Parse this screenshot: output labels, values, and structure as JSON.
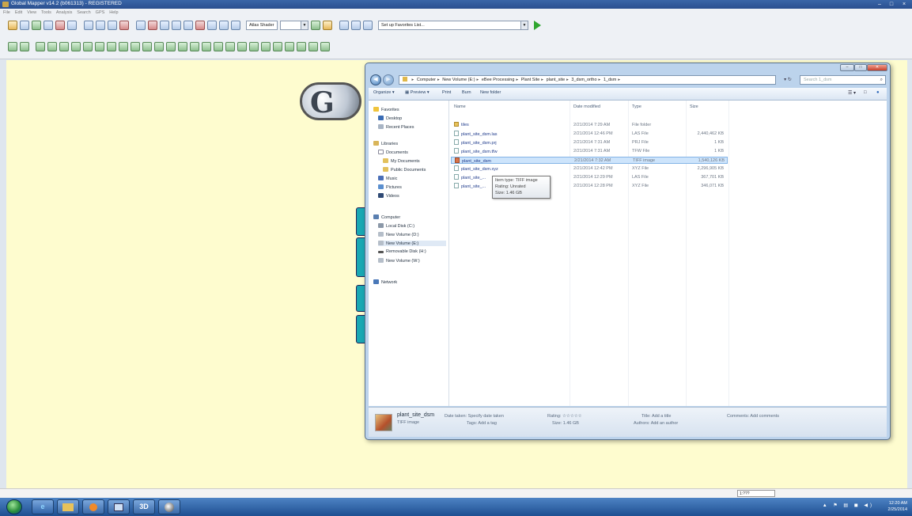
{
  "app": {
    "title": "Global Mapper v14.2 (b061313) - REGISTERED",
    "menu": [
      "File",
      "Edit",
      "View",
      "Tools",
      "Analysis",
      "Search",
      "GPS",
      "Help"
    ],
    "shader_combo": "Atlas Shader",
    "favorites_combo": "Set up Favorites List...",
    "scale_readout": "1:??? "
  },
  "explorer": {
    "breadcrumb": [
      "Computer",
      "New Volume (E:)",
      "eBee Processing",
      "Plant Site",
      "plant_site",
      "3_dsm_ortho",
      "1_dsm"
    ],
    "search_placeholder": "Search 1_dsm",
    "commands": [
      "Organize",
      "Preview",
      "Print",
      "Burn",
      "New folder"
    ],
    "nav": {
      "favorites": "Favorites",
      "desktop": "Desktop",
      "recent": "Recent Places",
      "libraries": "Libraries",
      "documents": "Documents",
      "my_documents": "My Documents",
      "public_documents": "Public Documents",
      "music": "Music",
      "pictures": "Pictures",
      "videos": "Videos",
      "computer": "Computer",
      "local_disk": "Local Disk (C:)",
      "vol_d": "New Volume (D:)",
      "vol_e": "New Volume (E:)",
      "removable": "Removable Disk (H:)",
      "vol_w": "New Volume (W:)",
      "network": "Network"
    },
    "columns": {
      "name": "Name",
      "date": "Date modified",
      "type": "Type",
      "size": "Size"
    },
    "files": [
      {
        "name": "tiles",
        "date": "2/21/2014 7:29 AM",
        "type": "File folder",
        "size": ""
      },
      {
        "name": "plant_site_dsm.las",
        "date": "2/21/2014 12:46 PM",
        "type": "LAS File",
        "size": "2,440,462 KB"
      },
      {
        "name": "plant_site_dsm.prj",
        "date": "2/21/2014 7:31 AM",
        "type": "PRJ File",
        "size": "1 KB"
      },
      {
        "name": "plant_site_dsm.tfw",
        "date": "2/21/2014 7:31 AM",
        "type": "TFW File",
        "size": "1 KB"
      },
      {
        "name": "plant_site_dsm",
        "date": "2/21/2014 7:32 AM",
        "type": "TIFF image",
        "size": "1,540,126 KB"
      },
      {
        "name": "plant_site_dsm.xyz",
        "date": "2/21/2014 12:42 PM",
        "type": "XYZ File",
        "size": "2,296,905 KB"
      },
      {
        "name": "plant_site_...",
        "date": "2/21/2014 12:29 PM",
        "type": "LAS File",
        "size": "367,701 KB"
      },
      {
        "name": "plant_site_...",
        "date": "2/21/2014 12:28 PM",
        "type": "XYZ File",
        "size": "346,071 KB"
      }
    ],
    "tooltip": [
      "Item type: TIFF image",
      "Rating: Unrated",
      "Size: 1.46 GB"
    ],
    "details": {
      "name": "plant_site_dsm",
      "kind": "TIFF image",
      "date_taken": "Date taken: Specify date taken",
      "tags": "Tags: Add a tag",
      "rating": "Rating: ☆☆☆☆☆",
      "size": "Size: 1.46 GB",
      "title": "Title: Add a title",
      "authors": "Authors: Add an author",
      "comments": "Comments: Add comments"
    }
  },
  "taskbar": {
    "time": "12:20 AM",
    "date": "2/25/2014",
    "app_3d": "3D"
  }
}
